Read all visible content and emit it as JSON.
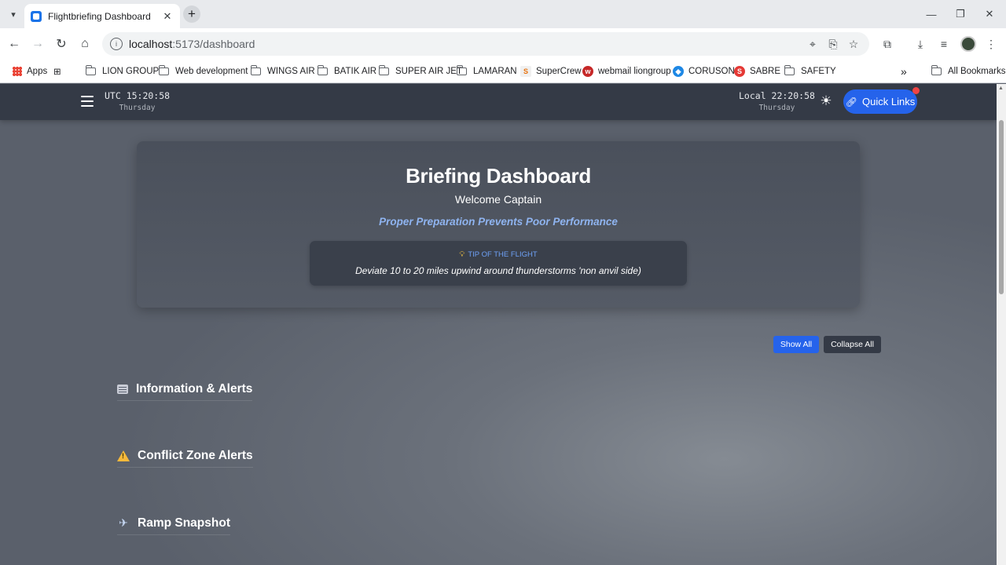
{
  "browser": {
    "tab_title": "Flightbriefing Dashboard",
    "url_host": "localhost",
    "url_path": ":5173/dashboard",
    "bookmarks": [
      {
        "label": "Apps",
        "icon": "apps-grid-icon"
      },
      {
        "label": "LION GROUP",
        "icon": "folder-icon"
      },
      {
        "label": "Web development",
        "icon": "folder-icon"
      },
      {
        "label": "WINGS AIR",
        "icon": "folder-icon"
      },
      {
        "label": "BATIK AIR",
        "icon": "folder-icon"
      },
      {
        "label": "SUPER AIR JET",
        "icon": "folder-icon"
      },
      {
        "label": "LAMARAN",
        "icon": "folder-icon"
      },
      {
        "label": "SuperCrew",
        "icon": "supercrew-icon"
      },
      {
        "label": "webmail liongroup",
        "icon": "webmail-icon"
      },
      {
        "label": "CORUSON",
        "icon": "coruson-icon"
      },
      {
        "label": "SABRE",
        "icon": "sabre-icon"
      },
      {
        "label": "SAFETY",
        "icon": "folder-icon"
      }
    ],
    "all_bookmarks": "All Bookmarks",
    "more": "»"
  },
  "header": {
    "utc_time": "UTC 15:20:58",
    "utc_day": "Thursday",
    "local_time": "Local 22:20:58",
    "local_day": "Thursday",
    "quick_links": "Quick Links"
  },
  "hero": {
    "title": "Briefing Dashboard",
    "welcome": "Welcome Captain",
    "motto": "Proper Preparation Prevents Poor Performance",
    "tip_label": "TIP OF THE FLIGHT",
    "tip_text": "Deviate 10 to 20 miles upwind around thunderstorms 'non anvil side)"
  },
  "controls": {
    "show_all": "Show All",
    "collapse_all": "Collapse All"
  },
  "sections": [
    {
      "title": "Information & Alerts",
      "icon": "news-icon"
    },
    {
      "title": "Conflict Zone Alerts",
      "icon": "warning-icon"
    },
    {
      "title": "Ramp Snapshot",
      "icon": "airplane-departure-icon"
    }
  ],
  "colors": {
    "accent": "#2563eb",
    "header_bg": "#343a46",
    "motto": "#8fb4f0",
    "tip_label": "#6ea0f5",
    "notification": "#ef4444"
  }
}
